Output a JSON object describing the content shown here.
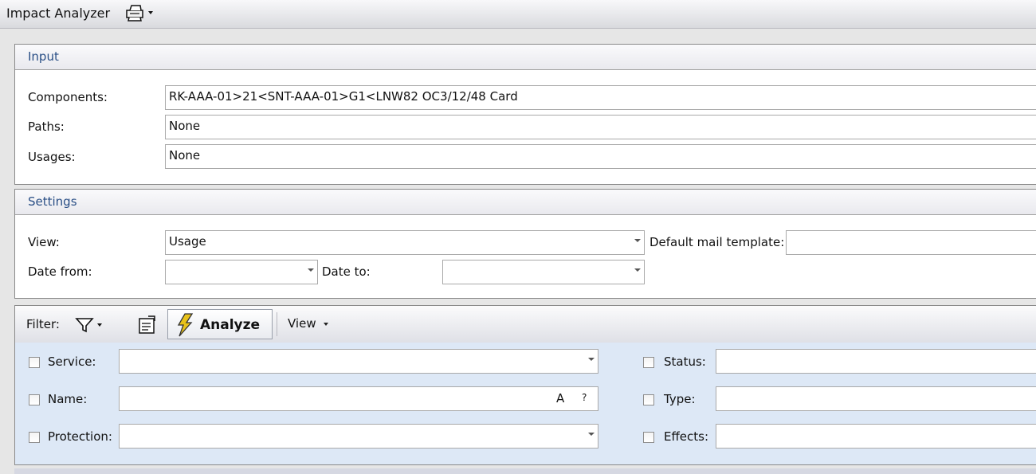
{
  "app": {
    "title": "Impact Analyzer",
    "print_icon": "printer-icon"
  },
  "input": {
    "header": "Input",
    "components_label": "Components:",
    "components_value": "RK-AAA-01>21<SNT-AAA-01>G1<LNW82 OC3/12/48 Card",
    "paths_label": "Paths:",
    "paths_value": "None",
    "usages_label": "Usages:",
    "usages_value": "None"
  },
  "settings": {
    "header": "Settings",
    "view_label": "View:",
    "view_value": "Usage",
    "mail_label": "Default mail template:",
    "mail_value": "",
    "date_from_label": "Date from:",
    "date_from_value": "",
    "date_to_label": "Date to:",
    "date_to_value": ""
  },
  "toolbar": {
    "filter_label": "Filter:",
    "filter_icon": "funnel-icon",
    "properties_icon": "properties-icon",
    "analyze_label": "Analyze",
    "analyze_icon": "lightning-icon",
    "view_label": "View"
  },
  "filters": {
    "service_label": "Service:",
    "service_value": "",
    "name_label": "Name:",
    "name_value": "",
    "name_a_glyph": "A",
    "name_q_glyph": "?",
    "protection_label": "Protection:",
    "protection_value": "",
    "status_label": "Status:",
    "status_value": "",
    "type_label": "Type:",
    "type_value": "",
    "effects_label": "Effects:",
    "effects_value": ""
  },
  "colors": {
    "section_header_text": "#2a4f86",
    "filter_panel_bg": "#dde8f6",
    "analyze_icon": "#e8c21a"
  }
}
